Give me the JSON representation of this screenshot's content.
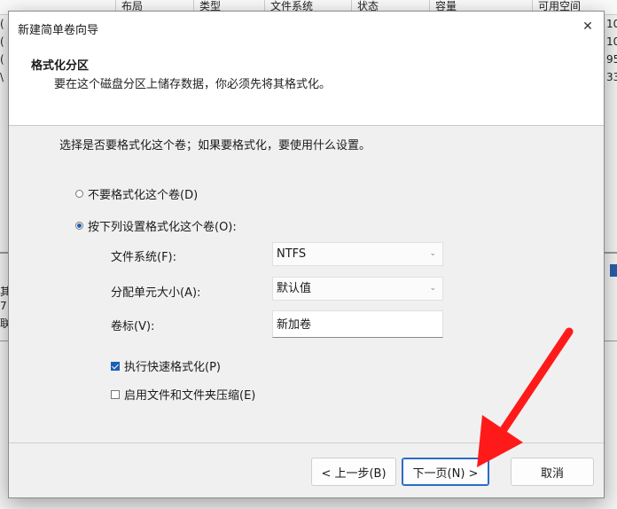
{
  "background": {
    "columns": [
      "布局",
      "类型",
      "文件系统",
      "状态",
      "容量",
      "可用空间"
    ],
    "right_cells": [
      "10",
      "10",
      "95",
      "33"
    ],
    "left_cells": [
      "(",
      "(",
      "(",
      "\\"
    ],
    "lower_left_cells": [
      "其",
      "7",
      "联"
    ]
  },
  "dialog": {
    "title": "新建简单卷向导",
    "close_symbol": "✕",
    "header_title": "格式化分区",
    "header_subtitle": "要在这个磁盘分区上储存数据，你必须先将其格式化。",
    "prompt": "选择是否要格式化这个卷；如果要格式化，要使用什么设置。",
    "option_no_format": "不要格式化这个卷(D)",
    "option_format": "按下列设置格式化这个卷(O):",
    "filesystem_label": "文件系统(F):",
    "filesystem_value": "NTFS",
    "allocation_label": "分配单元大小(A):",
    "allocation_value": "默认值",
    "volume_label": "卷标(V):",
    "volume_value": "新加卷",
    "quick_format": "执行快速格式化(P)",
    "compression": "启用文件和文件夹压缩(E)",
    "back_button": "< 上一步(B)",
    "next_button": "下一页(N) >",
    "cancel_button": "取消"
  },
  "annotation": {
    "arrow_color": "#ff1a1a"
  }
}
